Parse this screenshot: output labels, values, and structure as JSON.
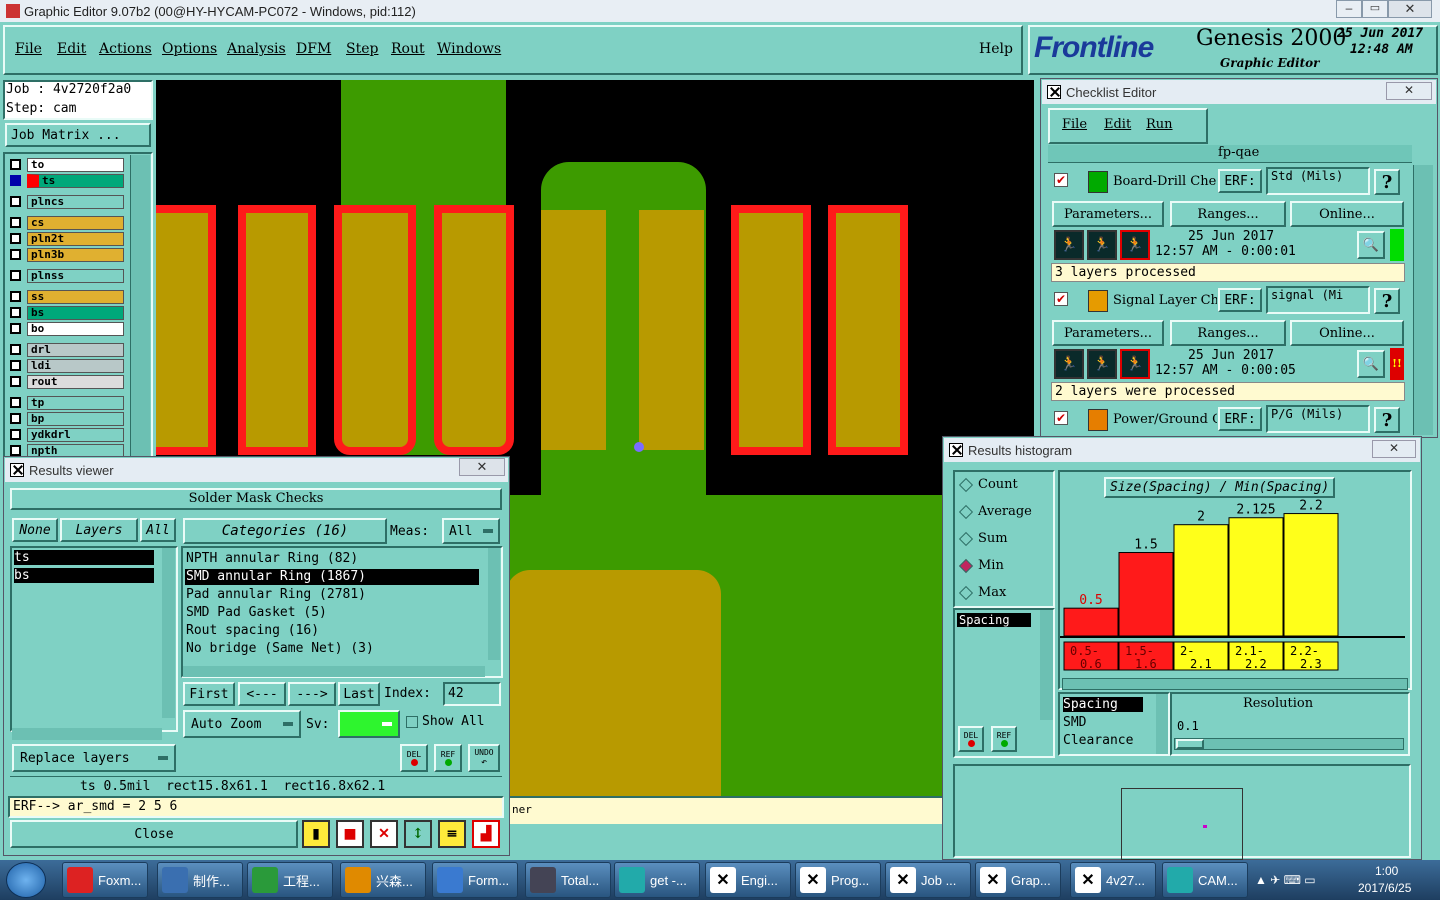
{
  "window": {
    "title": "Graphic Editor 9.07b2 (00@HY-HYCAM-PC072 - Windows, pid:112)"
  },
  "menu": {
    "file": "File",
    "edit": "Edit",
    "actions": "Actions",
    "options": "Options",
    "analysis": "Analysis",
    "dfm": "DFM",
    "step": "Step",
    "rout": "Rout",
    "windows": "Windows",
    "help": "Help"
  },
  "brand": {
    "logo": "Frontline",
    "product": "Genesis 2000",
    "subtitle": "Graphic Editor",
    "date": "25 Jun 2017",
    "time": "12:48 AM"
  },
  "job": {
    "job_line": "Job : 4v2720f2a0",
    "step_line": "Step: cam",
    "matrix_button": "Job Matrix ..."
  },
  "layers": [
    "to",
    "ts",
    "plncs",
    "cs",
    "pln2t",
    "pln3b",
    "plnss",
    "ss",
    "bs",
    "bo",
    "drl",
    "ldi",
    "rout",
    "tp",
    "bp",
    "ydkdrl",
    "npth"
  ],
  "checklist": {
    "title": "Checklist Editor",
    "menu_file": "File",
    "menu_edit": "Edit",
    "menu_run": "Run",
    "name": "fp-qae",
    "erf_label": "ERF:",
    "help_glyph": "?",
    "parameters": "Parameters...",
    "ranges": "Ranges...",
    "online": "Online...",
    "items": [
      {
        "name": "Board-Drill Che",
        "erf": "Std (Mils)",
        "date": "25 Jun 2017",
        "time": "12:57 AM - 0:00:01",
        "status": "3 layers processed"
      },
      {
        "name": "Signal Layer Ch",
        "erf": "signal (Mi",
        "date": "25 Jun 2017",
        "time": "12:57 AM - 0:00:05",
        "status": "2 layers were processed",
        "flag": "!!"
      },
      {
        "name": "Power/Ground C",
        "erf": "P/G (Mils)"
      }
    ]
  },
  "results_viewer": {
    "title": "Results viewer",
    "header": "Solder Mask Checks",
    "none": "None",
    "layers": "Layers",
    "all": "All",
    "categories": "Categories (16)",
    "meas_label": "Meas:",
    "meas_value": "All",
    "layer_list": [
      "ts",
      "bs"
    ],
    "category_list": [
      "NPTH annular Ring (82)",
      "SMD annular Ring (1867)",
      "Pad annular Ring (2781)",
      "SMD Pad Gasket (5)",
      "Rout spacing (16)",
      "No bridge (Same Net) (3)"
    ],
    "selected_category": "SMD annular Ring (1867)",
    "first": "First",
    "prev": "<---",
    "next": "--->",
    "last": "Last",
    "index_label": "Index:",
    "index_value": "42",
    "auto_zoom": "Auto Zoom",
    "sv_label": "Sv:",
    "show_all": "Show All",
    "replace_layers": "Replace layers",
    "del": "DEL",
    "ref": "REF",
    "undo": "UNDO",
    "info_line": "ts 0.5mil  rect15.8x61.1  rect16.8x62.1",
    "erf_line": "ERF--> ar_smd = 2 5 6",
    "close": "Close"
  },
  "canvas": {
    "status_fragment": "ner"
  },
  "histogram": {
    "title": "Results histogram",
    "options": [
      "Count",
      "Average",
      "Sum",
      "Min",
      "Max"
    ],
    "selected_option": "Min",
    "list_items": [
      "Spacing"
    ],
    "bottom_list": [
      "Spacing",
      "SMD",
      "Clearance"
    ],
    "resolution_label": "Resolution",
    "resolution_value": "0.1",
    "del": "DEL",
    "ref": "REF"
  },
  "chart_data": {
    "type": "bar",
    "title": "Size(Spacing) / Min(Spacing)",
    "categories": [
      "0.5-0.6",
      "1.5-1.6",
      "2-2.1",
      "2.1-2.2",
      "2.2-2.3"
    ],
    "values": [
      0.5,
      1.5,
      2,
      2.125,
      2.2
    ],
    "value_labels": [
      "0.5",
      "1.5",
      "2",
      "2.125",
      "2.2"
    ],
    "colors": [
      "#ff1a1a",
      "#ff1a1a",
      "#ffff1a",
      "#ffff1a",
      "#ffff1a"
    ],
    "ylim": [
      0,
      2.3
    ]
  },
  "taskbar": {
    "items": [
      "Foxm...",
      "制作...",
      "工程...",
      "兴森...",
      "Form...",
      "Total...",
      "get -...",
      "Engi...",
      "Prog...",
      "Job ...",
      "Grap...",
      "4v27...",
      "CAM..."
    ],
    "time": "1:00",
    "date": "2017/6/25"
  }
}
